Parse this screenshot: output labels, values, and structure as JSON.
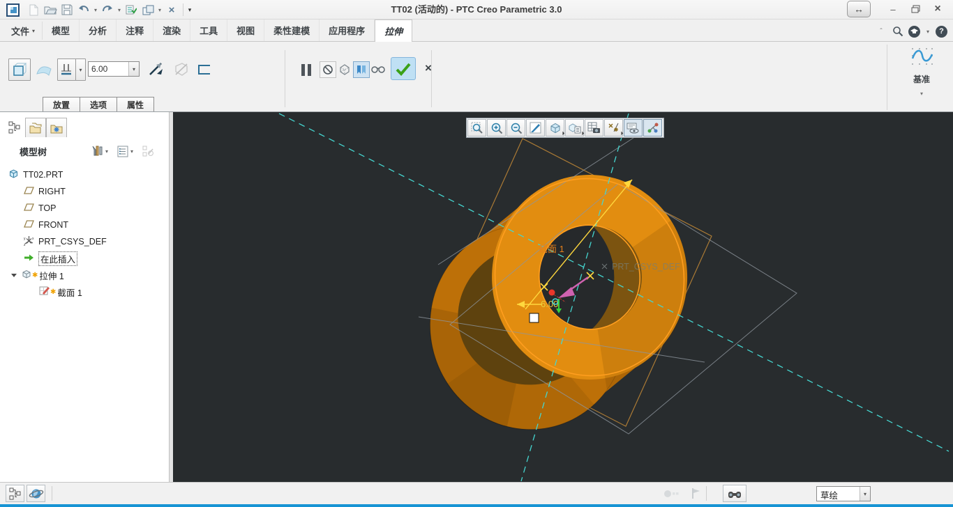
{
  "window": {
    "title": "TT02 (活动的) - PTC Creo Parametric 3.0"
  },
  "menu_tabs": {
    "file": "文件",
    "items": [
      "模型",
      "分析",
      "注释",
      "渲染",
      "工具",
      "视图",
      "柔性建模",
      "应用程序"
    ],
    "active": "拉伸"
  },
  "ribbon": {
    "depth_value": "6.00",
    "datum_group_label": "基准",
    "panel_tabs": [
      "放置",
      "选项",
      "属性"
    ]
  },
  "navigator": {
    "header": "模型树"
  },
  "model_tree": {
    "items": [
      {
        "label": "TT02.PRT"
      },
      {
        "label": "RIGHT"
      },
      {
        "label": "TOP"
      },
      {
        "label": "FRONT"
      },
      {
        "label": "PRT_CSYS_DEF"
      },
      {
        "label": "在此插入"
      },
      {
        "label": "拉伸 1"
      },
      {
        "label": "截面 1"
      }
    ]
  },
  "viewport": {
    "section_label": "截面 1",
    "csys_label": "PRT_CSYS_DEF",
    "depth_dimension": "6.00"
  },
  "statusbar": {
    "filter_value": "草绘"
  },
  "colors": {
    "viewport_bg": "#282c2e",
    "model_orange": "#e28d10",
    "sketch_orange": "#ff9e1f",
    "axis_cyan": "#45d6d0",
    "dimension_yellow": "#ffd83e",
    "status_blue": "#1794d4"
  }
}
